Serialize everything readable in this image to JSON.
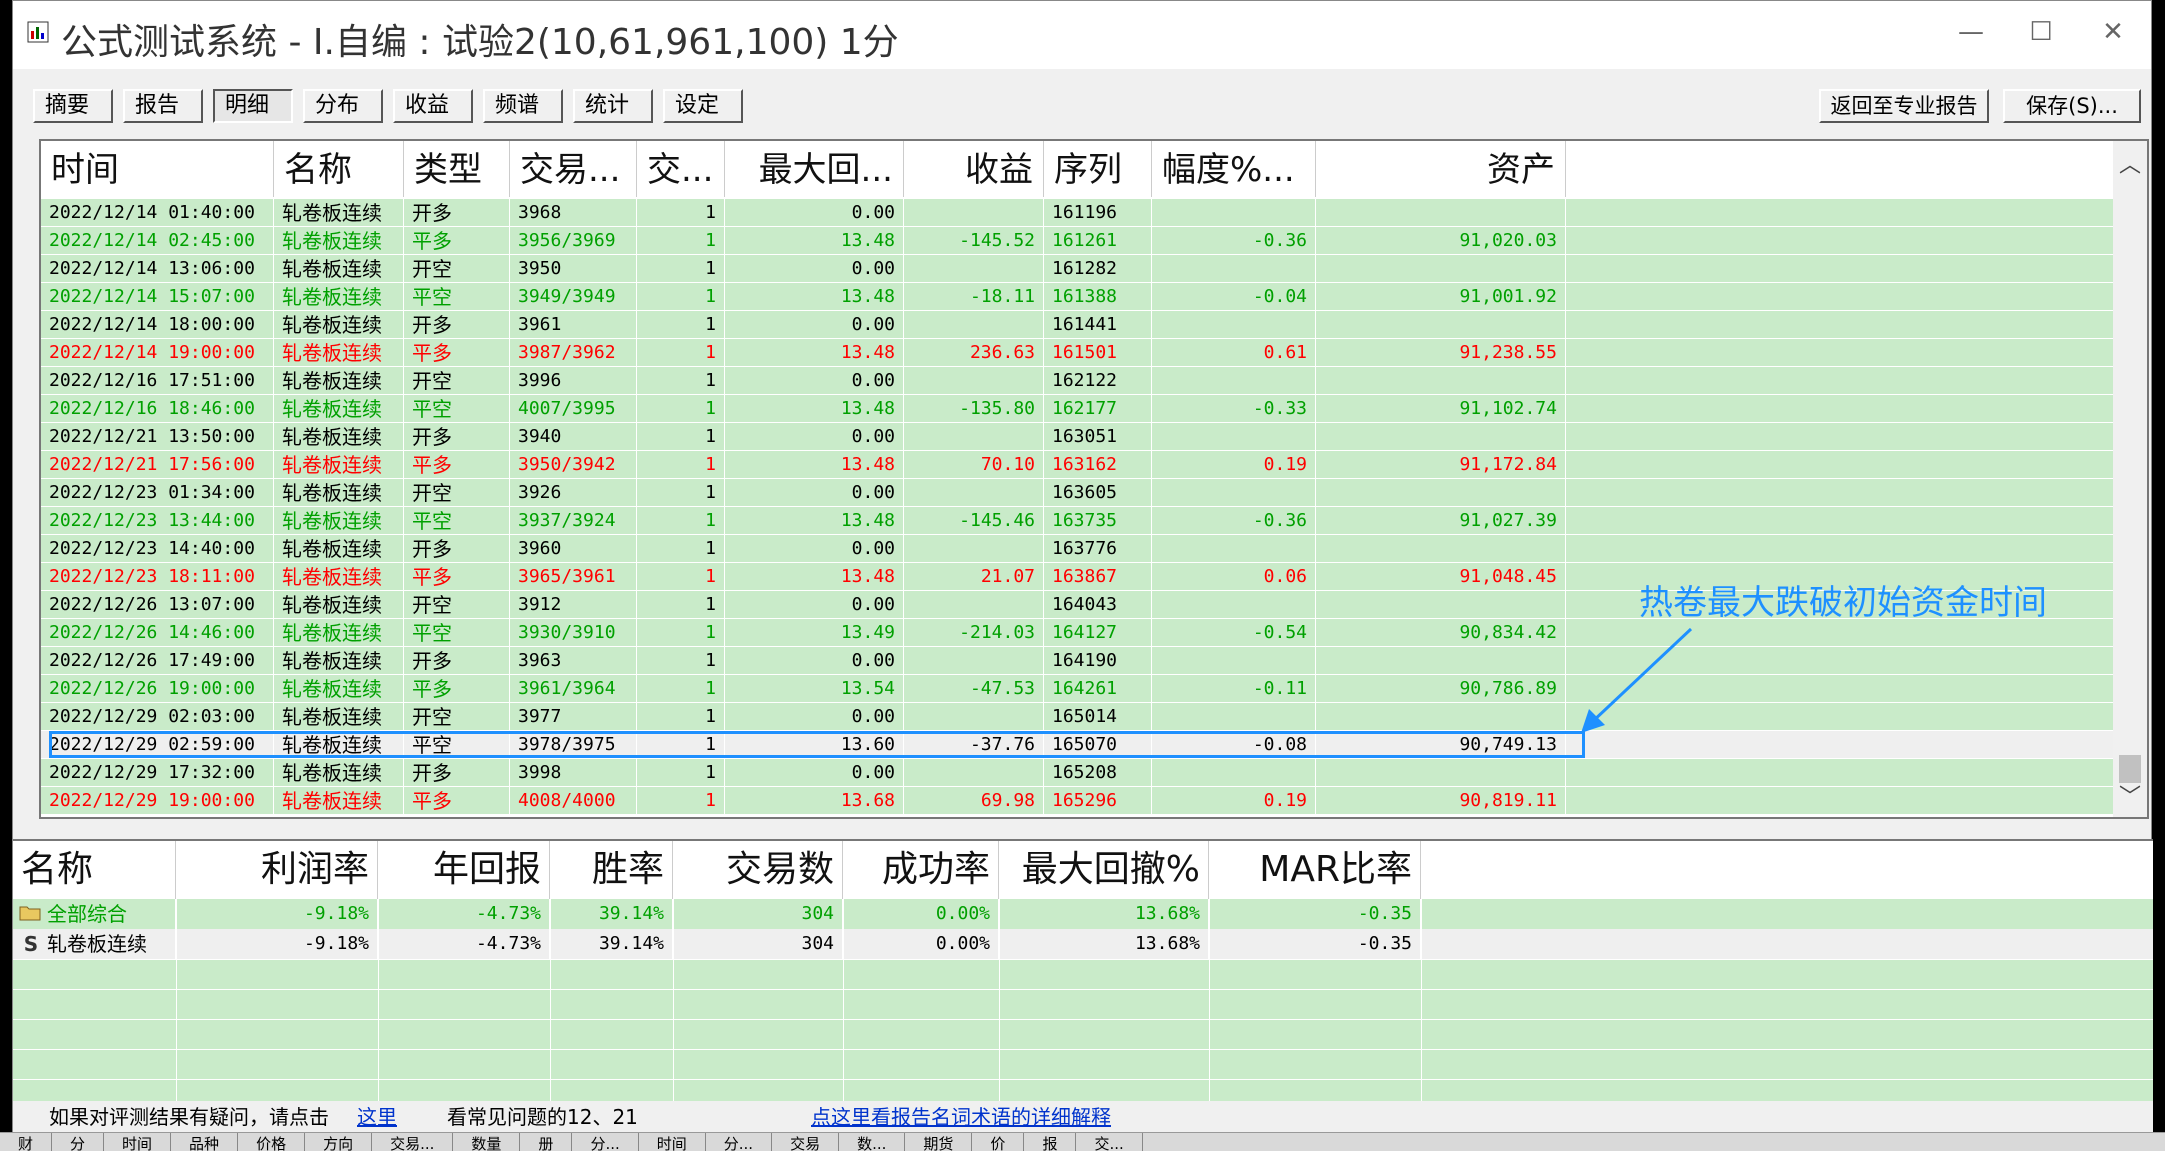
{
  "window": {
    "title": "公式测试系统 - I.自编 : 试验2(10,61,961,100) 1分",
    "minimize_glyph": "—",
    "maximize_glyph": "☐",
    "close_glyph": "✕"
  },
  "tabs": [
    {
      "label": "摘要",
      "active": false
    },
    {
      "label": "报告",
      "active": false
    },
    {
      "label": "明细",
      "active": true
    },
    {
      "label": "分布",
      "active": false
    },
    {
      "label": "收益",
      "active": false
    },
    {
      "label": "频谱",
      "active": false
    },
    {
      "label": "统计",
      "active": false
    },
    {
      "label": "设定",
      "active": false
    }
  ],
  "right_buttons": {
    "back_label": "返回至专业报告",
    "save_label": "保存(S)..."
  },
  "detail_table": {
    "columns": [
      "时间",
      "名称",
      "类型",
      "交易...",
      "交...",
      "最大回...",
      "收益",
      "序列",
      "幅度%...",
      "资产"
    ],
    "rows": [
      {
        "color": "black",
        "time": "2022/12/14 01:40:00",
        "name": "轧卷板连续",
        "type": "开多",
        "price": "3968",
        "qty": "1",
        "maxdd": "0.00",
        "profit": "",
        "seq": "161196",
        "pct": "",
        "asset": ""
      },
      {
        "color": "green",
        "time": "2022/12/14 02:45:00",
        "name": "轧卷板连续",
        "type": "平多",
        "price": "3956/3969",
        "qty": "1",
        "maxdd": "13.48",
        "profit": "-145.52",
        "seq": "161261",
        "pct": "-0.36",
        "asset": "91,020.03"
      },
      {
        "color": "black",
        "time": "2022/12/14 13:06:00",
        "name": "轧卷板连续",
        "type": "开空",
        "price": "3950",
        "qty": "1",
        "maxdd": "0.00",
        "profit": "",
        "seq": "161282",
        "pct": "",
        "asset": ""
      },
      {
        "color": "green",
        "time": "2022/12/14 15:07:00",
        "name": "轧卷板连续",
        "type": "平空",
        "price": "3949/3949",
        "qty": "1",
        "maxdd": "13.48",
        "profit": "-18.11",
        "seq": "161388",
        "pct": "-0.04",
        "asset": "91,001.92"
      },
      {
        "color": "black",
        "time": "2022/12/14 18:00:00",
        "name": "轧卷板连续",
        "type": "开多",
        "price": "3961",
        "qty": "1",
        "maxdd": "0.00",
        "profit": "",
        "seq": "161441",
        "pct": "",
        "asset": ""
      },
      {
        "color": "red",
        "time": "2022/12/14 19:00:00",
        "name": "轧卷板连续",
        "type": "平多",
        "price": "3987/3962",
        "qty": "1",
        "maxdd": "13.48",
        "profit": "236.63",
        "seq": "161501",
        "pct": "0.61",
        "asset": "91,238.55"
      },
      {
        "color": "black",
        "time": "2022/12/16 17:51:00",
        "name": "轧卷板连续",
        "type": "开空",
        "price": "3996",
        "qty": "1",
        "maxdd": "0.00",
        "profit": "",
        "seq": "162122",
        "pct": "",
        "asset": ""
      },
      {
        "color": "green",
        "time": "2022/12/16 18:46:00",
        "name": "轧卷板连续",
        "type": "平空",
        "price": "4007/3995",
        "qty": "1",
        "maxdd": "13.48",
        "profit": "-135.80",
        "seq": "162177",
        "pct": "-0.33",
        "asset": "91,102.74"
      },
      {
        "color": "black",
        "time": "2022/12/21 13:50:00",
        "name": "轧卷板连续",
        "type": "开多",
        "price": "3940",
        "qty": "1",
        "maxdd": "0.00",
        "profit": "",
        "seq": "163051",
        "pct": "",
        "asset": ""
      },
      {
        "color": "red",
        "time": "2022/12/21 17:56:00",
        "name": "轧卷板连续",
        "type": "平多",
        "price": "3950/3942",
        "qty": "1",
        "maxdd": "13.48",
        "profit": "70.10",
        "seq": "163162",
        "pct": "0.19",
        "asset": "91,172.84"
      },
      {
        "color": "black",
        "time": "2022/12/23 01:34:00",
        "name": "轧卷板连续",
        "type": "开空",
        "price": "3926",
        "qty": "1",
        "maxdd": "0.00",
        "profit": "",
        "seq": "163605",
        "pct": "",
        "asset": ""
      },
      {
        "color": "green",
        "time": "2022/12/23 13:44:00",
        "name": "轧卷板连续",
        "type": "平空",
        "price": "3937/3924",
        "qty": "1",
        "maxdd": "13.48",
        "profit": "-145.46",
        "seq": "163735",
        "pct": "-0.36",
        "asset": "91,027.39"
      },
      {
        "color": "black",
        "time": "2022/12/23 14:40:00",
        "name": "轧卷板连续",
        "type": "开多",
        "price": "3960",
        "qty": "1",
        "maxdd": "0.00",
        "profit": "",
        "seq": "163776",
        "pct": "",
        "asset": ""
      },
      {
        "color": "red",
        "time": "2022/12/23 18:11:00",
        "name": "轧卷板连续",
        "type": "平多",
        "price": "3965/3961",
        "qty": "1",
        "maxdd": "13.48",
        "profit": "21.07",
        "seq": "163867",
        "pct": "0.06",
        "asset": "91,048.45"
      },
      {
        "color": "black",
        "time": "2022/12/26 13:07:00",
        "name": "轧卷板连续",
        "type": "开空",
        "price": "3912",
        "qty": "1",
        "maxdd": "0.00",
        "profit": "",
        "seq": "164043",
        "pct": "",
        "asset": ""
      },
      {
        "color": "green",
        "time": "2022/12/26 14:46:00",
        "name": "轧卷板连续",
        "type": "平空",
        "price": "3930/3910",
        "qty": "1",
        "maxdd": "13.49",
        "profit": "-214.03",
        "seq": "164127",
        "pct": "-0.54",
        "asset": "90,834.42"
      },
      {
        "color": "black",
        "time": "2022/12/26 17:49:00",
        "name": "轧卷板连续",
        "type": "开多",
        "price": "3963",
        "qty": "1",
        "maxdd": "0.00",
        "profit": "",
        "seq": "164190",
        "pct": "",
        "asset": ""
      },
      {
        "color": "green",
        "time": "2022/12/26 19:00:00",
        "name": "轧卷板连续",
        "type": "平多",
        "price": "3961/3964",
        "qty": "1",
        "maxdd": "13.54",
        "profit": "-47.53",
        "seq": "164261",
        "pct": "-0.11",
        "asset": "90,786.89"
      },
      {
        "color": "black",
        "time": "2022/12/29 02:03:00",
        "name": "轧卷板连续",
        "type": "开空",
        "price": "3977",
        "qty": "1",
        "maxdd": "0.00",
        "profit": "",
        "seq": "165014",
        "pct": "",
        "asset": ""
      },
      {
        "color": "black",
        "selected": true,
        "time": "2022/12/29 02:59:00",
        "name": "轧卷板连续",
        "type": "平空",
        "price": "3978/3975",
        "qty": "1",
        "maxdd": "13.60",
        "profit": "-37.76",
        "seq": "165070",
        "pct": "-0.08",
        "asset": "90,749.13"
      },
      {
        "color": "black",
        "time": "2022/12/29 17:32:00",
        "name": "轧卷板连续",
        "type": "开多",
        "price": "3998",
        "qty": "1",
        "maxdd": "0.00",
        "profit": "",
        "seq": "165208",
        "pct": "",
        "asset": ""
      },
      {
        "color": "red",
        "time": "2022/12/29 19:00:00",
        "name": "轧卷板连续",
        "type": "平多",
        "price": "4008/4000",
        "qty": "1",
        "maxdd": "13.68",
        "profit": "69.98",
        "seq": "165296",
        "pct": "0.19",
        "asset": "90,819.11"
      }
    ],
    "scroll_up_glyph": "︿",
    "scroll_down_glyph": "﹀"
  },
  "annotation": {
    "text": "热卷最大跌破初始资金时间",
    "color": "#1e90ff"
  },
  "summary_table": {
    "columns": [
      "名称",
      "利润率",
      "年回报",
      "胜率",
      "交易数",
      "成功率",
      "最大回撤%",
      "MAR比率"
    ],
    "rows": [
      {
        "icon": "folder-icon",
        "color": "green",
        "name": "全部综合",
        "profit_rate": "-9.18%",
        "annual": "-4.73%",
        "win": "39.14%",
        "trades": "304",
        "success": "0.00%",
        "maxdd": "13.68%",
        "mar": "-0.35"
      },
      {
        "icon": "s-icon",
        "icon_glyph": "S",
        "color": "black",
        "name": "轧卷板连续",
        "profit_rate": "-9.18%",
        "annual": "-4.73%",
        "win": "39.14%",
        "trades": "304",
        "success": "0.00%",
        "maxdd": "13.68%",
        "mar": "-0.35"
      }
    ]
  },
  "status": {
    "question_text": "如果对评测结果有疑问，请点击",
    "here_link": "这里",
    "faq_text": "看常见问题的12、21",
    "glossary_link": "点这里看报告名词术语的详细解释"
  },
  "background_strip": [
    "财",
    "分",
    "时间",
    "品种",
    "价格",
    "方向",
    "交易...",
    "数量",
    "册",
    "分...",
    "时间",
    "分...",
    "交易",
    "数...",
    "期货",
    "价",
    "报",
    "交..."
  ]
}
